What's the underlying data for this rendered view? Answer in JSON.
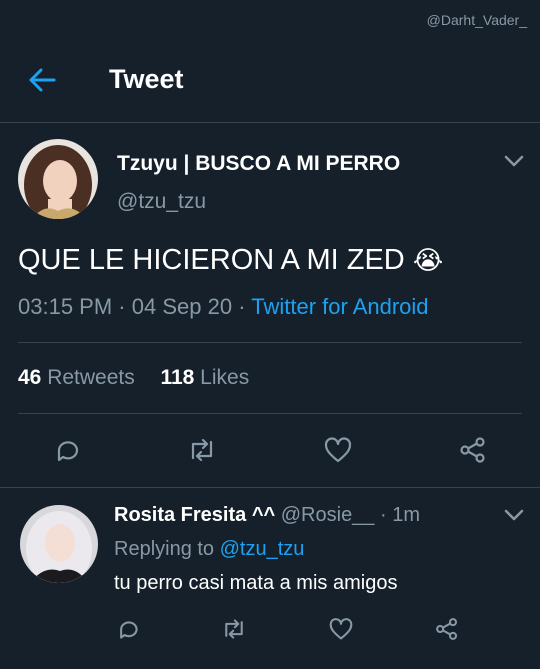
{
  "watermark": "@Darht_Vader_",
  "header": {
    "title": "Tweet"
  },
  "tweet": {
    "author_name": "Tzuyu | BUSCO A MI PERRO",
    "author_handle": "@tzu_tzu",
    "text": "QUE LE HICIERON A MI ZED",
    "emoji": "😭",
    "time": "03:15 PM",
    "date": "04 Sep 20",
    "client": "Twitter for Android",
    "retweets_count": "46",
    "retweets_label": "Retweets",
    "likes_count": "118",
    "likes_label": "Likes"
  },
  "reply": {
    "author_name": "Rosita Fresita ^^",
    "author_handle": "@Rosie__",
    "age": "1m",
    "replying_prefix": "Replying to",
    "replying_to": "@tzu_tzu",
    "text": "tu perro casi mata a mis amigos"
  },
  "colors": {
    "background": "#15202b",
    "accent": "#1da1f2",
    "muted": "#8899a6",
    "divider": "#38444d"
  },
  "icons": [
    "back-arrow-icon",
    "chevron-down-icon",
    "reply-icon",
    "retweet-icon",
    "like-icon",
    "share-icon"
  ]
}
